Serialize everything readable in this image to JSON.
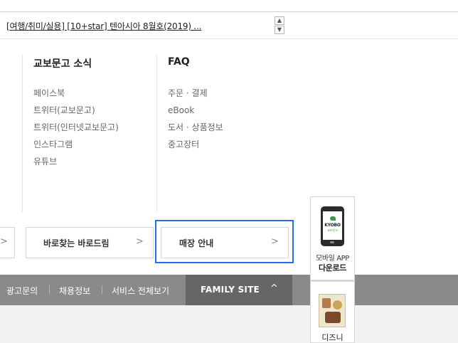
{
  "news": {
    "text": "[여행/취미/실용] [10+star] 텐아시아 8월호(2019) ...",
    "up_icon": "chevron-up-icon",
    "down_icon": "chevron-down-icon"
  },
  "columns": [
    {
      "title": "교보문고 소식",
      "links": [
        "페이스북",
        "트위터(교보문고)",
        "트위터(인터넷교보문고)",
        "인스타그램",
        "유튜브"
      ]
    },
    {
      "title": "FAQ",
      "links": [
        "주문 · 결제",
        "eBook",
        "도서 · 상품정보",
        "중고장터"
      ]
    }
  ],
  "banners": {
    "left_chevron": ">",
    "barcode": {
      "label": "바로찾는 바로드림",
      "chevron": ">"
    },
    "store": {
      "label": "매장 안내",
      "chevron": ">"
    }
  },
  "footer": {
    "links": [
      "광고문의",
      "채용정보",
      "서비스 전체보기"
    ],
    "family_site": "FAMILY SITE",
    "family_icon": "chevron-up-icon"
  },
  "quick": {
    "app_caption_1": "모바일 APP",
    "app_caption_2": "다운로드",
    "app_brand": "KYOBO",
    "app_brand_sub": "교보문고",
    "promo_caption": "디즈니"
  },
  "colors": {
    "focus": "#1a73e8",
    "footer_bar": "#8a8a8a",
    "family_bg": "#666666"
  }
}
